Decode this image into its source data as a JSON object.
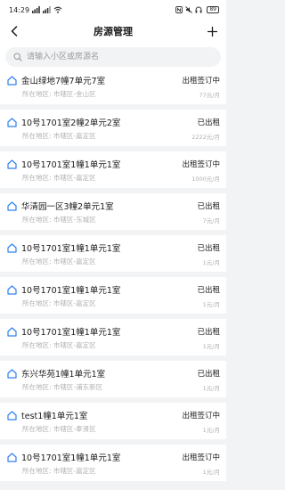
{
  "status_bar": {
    "time": "14:29",
    "battery": "89"
  },
  "header": {
    "title": "房源管理",
    "back_icon": "chevron-left-icon",
    "add_icon": "plus-icon"
  },
  "search": {
    "placeholder": "请输入小区或房源名"
  },
  "properties": [
    {
      "name": "金山绿地7幢7单元7室",
      "status": "出租签订中",
      "address": "所在地区: 市辖区-金山区",
      "price": "77元/月"
    },
    {
      "name": "10号1701室2幢2单元2室",
      "status": "已出租",
      "address": "所在地区: 市辖区-嘉定区",
      "price": "2222元/月"
    },
    {
      "name": "10号1701室1幢1单元1室",
      "status": "出租签订中",
      "address": "所在地区: 市辖区-嘉定区",
      "price": "1000元/月"
    },
    {
      "name": "华清园一区3幢2单元1室",
      "status": "已出租",
      "address": "所在地区: 市辖区-东城区",
      "price": "7元/月"
    },
    {
      "name": "10号1701室1幢1单元1室",
      "status": "已出租",
      "address": "所在地区: 市辖区-嘉定区",
      "price": "1元/月"
    },
    {
      "name": "10号1701室1幢1单元1室",
      "status": "已出租",
      "address": "所在地区: 市辖区-嘉定区",
      "price": "1元/月"
    },
    {
      "name": "10号1701室1幢1单元1室",
      "status": "已出租",
      "address": "所在地区: 市辖区-嘉定区",
      "price": "1元/月"
    },
    {
      "name": "东兴华苑1幢1单元1室",
      "status": "已出租",
      "address": "所在地区: 市辖区-浦东新区",
      "price": "1元/月"
    },
    {
      "name": "test1幢1单元1室",
      "status": "出租签订中",
      "address": "所在地区: 市辖区-奉贤区",
      "price": "1元/月"
    },
    {
      "name": "10号1701室1幢1单元1室",
      "status": "出租签订中",
      "address": "所在地区: 市辖区-嘉定区",
      "price": "1元/月"
    }
  ],
  "colors": {
    "accent": "#2f80ed",
    "background": "#f2f3f5",
    "muted_text": "#b0b0b0"
  }
}
